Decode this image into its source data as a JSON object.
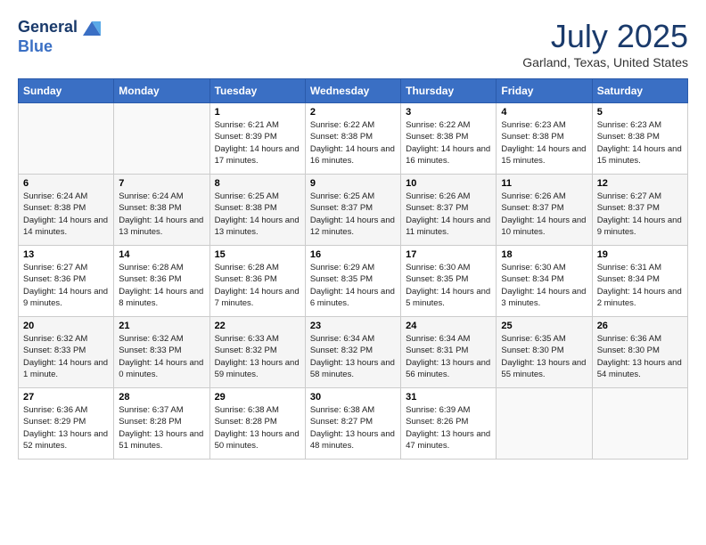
{
  "header": {
    "logo_line1": "General",
    "logo_line2": "Blue",
    "month_title": "July 2025",
    "location": "Garland, Texas, United States"
  },
  "weekdays": [
    "Sunday",
    "Monday",
    "Tuesday",
    "Wednesday",
    "Thursday",
    "Friday",
    "Saturday"
  ],
  "weeks": [
    [
      {
        "day": "",
        "info": ""
      },
      {
        "day": "",
        "info": ""
      },
      {
        "day": "1",
        "info": "Sunrise: 6:21 AM\nSunset: 8:39 PM\nDaylight: 14 hours and 17 minutes."
      },
      {
        "day": "2",
        "info": "Sunrise: 6:22 AM\nSunset: 8:38 PM\nDaylight: 14 hours and 16 minutes."
      },
      {
        "day": "3",
        "info": "Sunrise: 6:22 AM\nSunset: 8:38 PM\nDaylight: 14 hours and 16 minutes."
      },
      {
        "day": "4",
        "info": "Sunrise: 6:23 AM\nSunset: 8:38 PM\nDaylight: 14 hours and 15 minutes."
      },
      {
        "day": "5",
        "info": "Sunrise: 6:23 AM\nSunset: 8:38 PM\nDaylight: 14 hours and 15 minutes."
      }
    ],
    [
      {
        "day": "6",
        "info": "Sunrise: 6:24 AM\nSunset: 8:38 PM\nDaylight: 14 hours and 14 minutes."
      },
      {
        "day": "7",
        "info": "Sunrise: 6:24 AM\nSunset: 8:38 PM\nDaylight: 14 hours and 13 minutes."
      },
      {
        "day": "8",
        "info": "Sunrise: 6:25 AM\nSunset: 8:38 PM\nDaylight: 14 hours and 13 minutes."
      },
      {
        "day": "9",
        "info": "Sunrise: 6:25 AM\nSunset: 8:37 PM\nDaylight: 14 hours and 12 minutes."
      },
      {
        "day": "10",
        "info": "Sunrise: 6:26 AM\nSunset: 8:37 PM\nDaylight: 14 hours and 11 minutes."
      },
      {
        "day": "11",
        "info": "Sunrise: 6:26 AM\nSunset: 8:37 PM\nDaylight: 14 hours and 10 minutes."
      },
      {
        "day": "12",
        "info": "Sunrise: 6:27 AM\nSunset: 8:37 PM\nDaylight: 14 hours and 9 minutes."
      }
    ],
    [
      {
        "day": "13",
        "info": "Sunrise: 6:27 AM\nSunset: 8:36 PM\nDaylight: 14 hours and 9 minutes."
      },
      {
        "day": "14",
        "info": "Sunrise: 6:28 AM\nSunset: 8:36 PM\nDaylight: 14 hours and 8 minutes."
      },
      {
        "day": "15",
        "info": "Sunrise: 6:28 AM\nSunset: 8:36 PM\nDaylight: 14 hours and 7 minutes."
      },
      {
        "day": "16",
        "info": "Sunrise: 6:29 AM\nSunset: 8:35 PM\nDaylight: 14 hours and 6 minutes."
      },
      {
        "day": "17",
        "info": "Sunrise: 6:30 AM\nSunset: 8:35 PM\nDaylight: 14 hours and 5 minutes."
      },
      {
        "day": "18",
        "info": "Sunrise: 6:30 AM\nSunset: 8:34 PM\nDaylight: 14 hours and 3 minutes."
      },
      {
        "day": "19",
        "info": "Sunrise: 6:31 AM\nSunset: 8:34 PM\nDaylight: 14 hours and 2 minutes."
      }
    ],
    [
      {
        "day": "20",
        "info": "Sunrise: 6:32 AM\nSunset: 8:33 PM\nDaylight: 14 hours and 1 minute."
      },
      {
        "day": "21",
        "info": "Sunrise: 6:32 AM\nSunset: 8:33 PM\nDaylight: 14 hours and 0 minutes."
      },
      {
        "day": "22",
        "info": "Sunrise: 6:33 AM\nSunset: 8:32 PM\nDaylight: 13 hours and 59 minutes."
      },
      {
        "day": "23",
        "info": "Sunrise: 6:34 AM\nSunset: 8:32 PM\nDaylight: 13 hours and 58 minutes."
      },
      {
        "day": "24",
        "info": "Sunrise: 6:34 AM\nSunset: 8:31 PM\nDaylight: 13 hours and 56 minutes."
      },
      {
        "day": "25",
        "info": "Sunrise: 6:35 AM\nSunset: 8:30 PM\nDaylight: 13 hours and 55 minutes."
      },
      {
        "day": "26",
        "info": "Sunrise: 6:36 AM\nSunset: 8:30 PM\nDaylight: 13 hours and 54 minutes."
      }
    ],
    [
      {
        "day": "27",
        "info": "Sunrise: 6:36 AM\nSunset: 8:29 PM\nDaylight: 13 hours and 52 minutes."
      },
      {
        "day": "28",
        "info": "Sunrise: 6:37 AM\nSunset: 8:28 PM\nDaylight: 13 hours and 51 minutes."
      },
      {
        "day": "29",
        "info": "Sunrise: 6:38 AM\nSunset: 8:28 PM\nDaylight: 13 hours and 50 minutes."
      },
      {
        "day": "30",
        "info": "Sunrise: 6:38 AM\nSunset: 8:27 PM\nDaylight: 13 hours and 48 minutes."
      },
      {
        "day": "31",
        "info": "Sunrise: 6:39 AM\nSunset: 8:26 PM\nDaylight: 13 hours and 47 minutes."
      },
      {
        "day": "",
        "info": ""
      },
      {
        "day": "",
        "info": ""
      }
    ]
  ]
}
